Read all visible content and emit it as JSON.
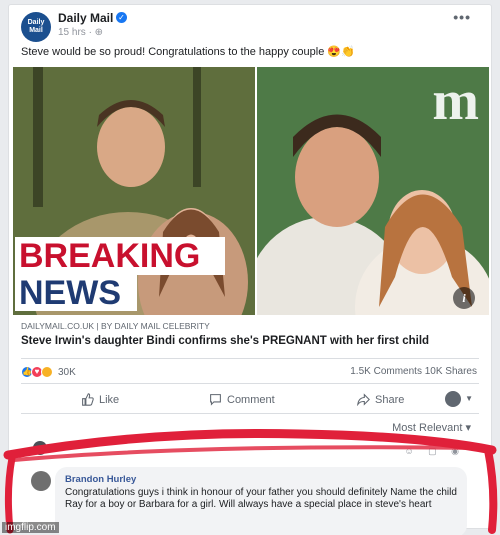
{
  "post": {
    "page_name": "Daily Mail",
    "avatar_line1": "Daily",
    "avatar_line2": "Mail",
    "time": "15 hrs · ⊕",
    "caption": "Steve would be so proud! Congratulations to the happy couple",
    "caption_emoji": "😍👏"
  },
  "image": {
    "overlay_line1": "BREAKING",
    "overlay_line2": "NEWS",
    "logo": "m",
    "info_label": "i"
  },
  "link": {
    "source": "DAILYMAIL.CO.UK | BY DAILY MAIL CELEBRITY",
    "headline": "Steve Irwin's daughter Bindi confirms she's PREGNANT with her first child"
  },
  "stats": {
    "reactions_count": "30K",
    "comments": "1.5K Comments",
    "shares": "10K Shares"
  },
  "actions": {
    "like": "Like",
    "comment": "Comment",
    "share": "Share"
  },
  "comments_section": {
    "sort_label": "Most Relevant ▾",
    "comment": {
      "author": "Brandon Hurley",
      "text": "Congratulations guys i think in honour of your father you should definitely Name the child Ray for a boy or Barbara for a girl. Will always have a special place in steve's heart"
    }
  },
  "watermark": "imgflip.com",
  "colors": {
    "facebook_blue": "#1877f2",
    "breaking_red": "#c8102e",
    "news_navy": "#1f3b73",
    "scribble_red": "#e0203a"
  }
}
